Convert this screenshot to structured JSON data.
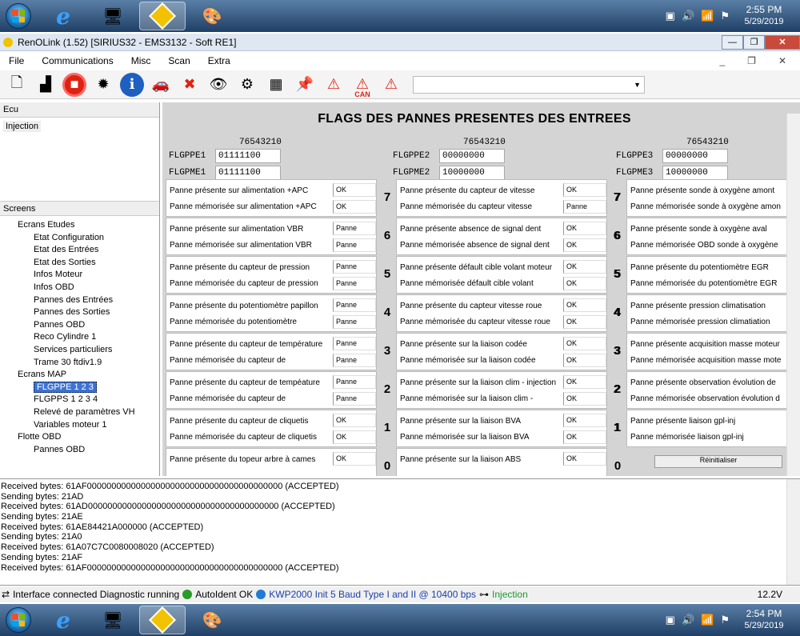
{
  "taskbar_top": {
    "time": "2:55 PM",
    "date": "5/29/2019"
  },
  "taskbar_bottom": {
    "time": "2:54 PM",
    "date": "5/29/2019"
  },
  "window": {
    "title": "RenOLink (1.52) [SIRIUS32 - EMS3132 - Soft RE1]"
  },
  "menu": [
    "File",
    "Communications",
    "Misc",
    "Scan",
    "Extra"
  ],
  "toolbar": {
    "can_label": "CAN"
  },
  "left": {
    "ecu_header": "Ecu",
    "ecu_item": "Injection",
    "screens_header": "Screens",
    "tree": [
      {
        "label": "Ecrans Etudes",
        "level": 0
      },
      {
        "label": "Etat Configuration",
        "level": 1
      },
      {
        "label": "Etat des Entrées",
        "level": 1
      },
      {
        "label": "Etat des Sorties",
        "level": 1
      },
      {
        "label": "Infos Moteur",
        "level": 1
      },
      {
        "label": "Infos OBD",
        "level": 1
      },
      {
        "label": "Pannes des Entrées",
        "level": 1
      },
      {
        "label": "Pannes des Sorties",
        "level": 1
      },
      {
        "label": "Pannes OBD",
        "level": 1
      },
      {
        "label": "Reco Cylindre 1",
        "level": 1
      },
      {
        "label": "Services particuliers",
        "level": 1
      },
      {
        "label": "Trame 30 ftdiv1.9",
        "level": 1
      },
      {
        "label": "Ecrans MAP",
        "level": 0
      },
      {
        "label": "FLGPPE 1 2 3",
        "level": 1,
        "selected": true
      },
      {
        "label": "FLGPPS 1 2 3 4",
        "level": 1
      },
      {
        "label": "Relevé de paramètres VH",
        "level": 1
      },
      {
        "label": "Variables moteur 1",
        "level": 1
      },
      {
        "label": "Flotte OBD",
        "level": 0
      },
      {
        "label": "Pannes OBD",
        "level": 1
      }
    ]
  },
  "main": {
    "title": "FLAGS DES PANNES PRESENTES DES ENTREES",
    "flags": [
      {
        "bits": "76543210",
        "label1": "FLGPPE1",
        "value1": "01111100",
        "label2": "FLGPME1",
        "value2": "01111100"
      },
      {
        "bits": "76543210",
        "label1": "FLGPPE2",
        "value1": "00000000",
        "label2": "FLGPME2",
        "value2": "10000000"
      },
      {
        "bits": "76543210",
        "label1": "FLGPPE3",
        "value1": "00000000",
        "label2": "FLGPME3",
        "value2": "10000000"
      }
    ],
    "bit_numbers": [
      "7",
      "6",
      "5",
      "4",
      "3",
      "2",
      "1",
      "0"
    ],
    "columns": [
      [
        {
          "present": "Panne présente sur alimentation +APC",
          "present_val": "OK",
          "memo": "Panne mémorisée sur alimentation +APC",
          "memo_val": "OK"
        },
        {
          "present": "Panne présente sur alimentation VBR",
          "present_val": "Panne",
          "memo": "Panne mémorisée sur alimentation VBR",
          "memo_val": "Panne"
        },
        {
          "present": "Panne présente du capteur de pression",
          "present_val": "Panne",
          "memo": "Panne mémorisée du capteur de pression",
          "memo_val": "Panne"
        },
        {
          "present": "Panne présente du potentiomètre papillon",
          "present_val": "Panne",
          "memo": "Panne mémorisée du potentiomètre",
          "memo_val": "Panne"
        },
        {
          "present": "Panne présente du capteur de température",
          "present_val": "Panne",
          "memo": "Panne mémorisée du capteur de",
          "memo_val": "Panne"
        },
        {
          "present": "Panne présente du capteur de tempéature",
          "present_val": "Panne",
          "memo": "Panne mémorisée du capteur de",
          "memo_val": "Panne"
        },
        {
          "present": "Panne présente du capteur de cliquetis",
          "present_val": "OK",
          "memo": "Panne mémorisée du capteur de cliquetis",
          "memo_val": "OK"
        },
        {
          "present": "Panne présente du topeur  arbre à cames",
          "present_val": "OK",
          "memo": "",
          "memo_val": ""
        }
      ],
      [
        {
          "present": "Panne présente du capteur de vitesse",
          "present_val": "OK",
          "memo": "Panne mémorisée du capteur vitesse",
          "memo_val": "Panne"
        },
        {
          "present": "Panne  présente absence de signal dent",
          "present_val": "OK",
          "memo": "Panne  mémorisée absence de signal dent",
          "memo_val": "OK"
        },
        {
          "present": "Panne présente défault cible volant moteur",
          "present_val": "OK",
          "memo": "Panne mémorisée défault cible volant",
          "memo_val": "OK"
        },
        {
          "present": "Panne présente du capteur vitesse roue",
          "present_val": "OK",
          "memo": "Panne mémorisée du capteur vitesse roue",
          "memo_val": "OK"
        },
        {
          "present": "Panne présente sur la liaison codée",
          "present_val": "OK",
          "memo": "Panne mémorisée sur la liaison codée",
          "memo_val": "OK"
        },
        {
          "present": "Panne présente sur la liaison clim - injection",
          "present_val": "OK",
          "memo": "Panne mémorisée sur la liaison clim -",
          "memo_val": "OK"
        },
        {
          "present": "Panne présente sur la liaison BVA",
          "present_val": "OK",
          "memo": "Panne mémorisée sur la liaison BVA",
          "memo_val": "OK"
        },
        {
          "present": "Panne présente sur la liaison ABS",
          "present_val": "OK",
          "memo": "",
          "memo_val": ""
        }
      ],
      [
        {
          "present": "Panne présente sonde à oxygène amont",
          "present_val": "",
          "memo": "Panne mémorisée sonde à oxygène amon",
          "memo_val": ""
        },
        {
          "present": "Panne présente sonde à oxygène aval",
          "present_val": "",
          "memo": "Panne mémorisée OBD sonde à oxygène",
          "memo_val": ""
        },
        {
          "present": "Panne présente du potentiomètre EGR",
          "present_val": "",
          "memo": "Panne mémorisée du potentiomètre EGR",
          "memo_val": ""
        },
        {
          "present": "Panne présente pression climatisation",
          "present_val": "",
          "memo": "Panne mémorisée pression climatiation",
          "memo_val": ""
        },
        {
          "present": "Panne présente acquisition masse moteur",
          "present_val": "",
          "memo": "Panne mémorisée acquisition masse mote",
          "memo_val": ""
        },
        {
          "present": "Panne présente observation évolution de",
          "present_val": "",
          "memo": "Panne mémorisée observation évolution d",
          "memo_val": ""
        },
        {
          "present": "Panne présente liaison gpl-inj",
          "present_val": "",
          "memo": "Panne mémorisée liaison gpl-inj",
          "memo_val": ""
        }
      ]
    ],
    "bottom_button": "Réinitialiser"
  },
  "log": [
    "Received bytes: 61AF0000000000000000000000000000000000000000 (ACCEPTED)",
    "Sending bytes: 21AD",
    "Received bytes: 61AD000000000000000000000000000000000000000 (ACCEPTED)",
    "Sending bytes: 21AE",
    "Received bytes: 61AE84421A000000 (ACCEPTED)",
    "Sending bytes: 21A0",
    "Received bytes: 61A07C7C0080008020 (ACCEPTED)",
    "Sending bytes: 21AF",
    "Received bytes: 61AF0000000000000000000000000000000000000000 (ACCEPTED)"
  ],
  "status": {
    "interface": "Interface connected Diagnostic running",
    "autoident": "AutoIdent OK",
    "protocol": "KWP2000 Init 5 Baud Type I and II @ 10400 bps",
    "ecu": "Injection",
    "voltage": "12.2V"
  },
  "colors": {
    "selection": "#3c74d6",
    "ok_green": "#2a9a2a",
    "protocol_blue": "#1a3fa8"
  }
}
